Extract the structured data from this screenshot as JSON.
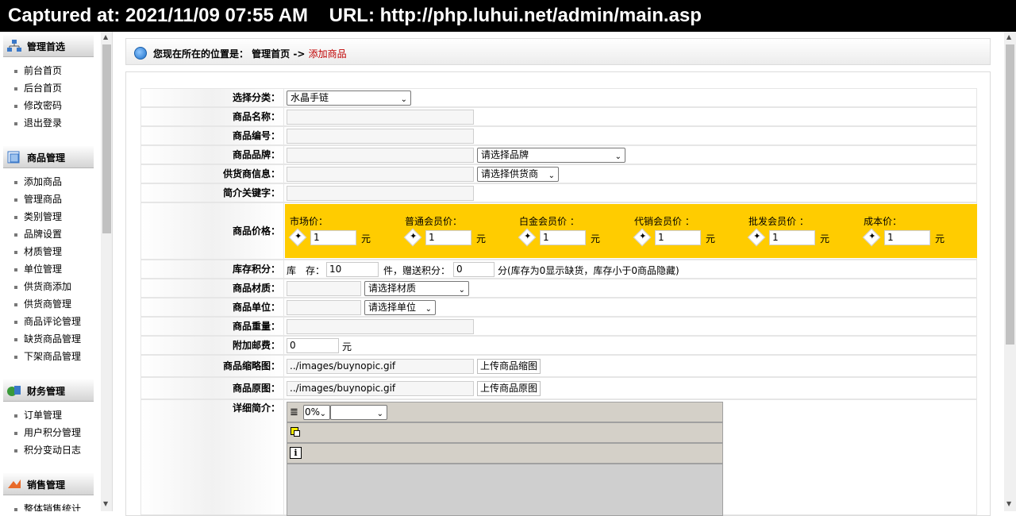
{
  "capture": {
    "text": "Captured at: 2021/11/09 07:55 AM    URL: http://php.luhui.net/admin/main.asp"
  },
  "sidebar": {
    "sections": [
      {
        "title": "管理首选",
        "items": [
          "前台首页",
          "后台首页",
          "修改密码",
          "退出登录"
        ]
      },
      {
        "title": "商品管理",
        "items": [
          "添加商品",
          "管理商品",
          "类别管理",
          "品牌设置",
          "材质管理",
          "单位管理",
          "供货商添加",
          "供货商管理",
          "商品评论管理",
          "缺货商品管理",
          "下架商品管理"
        ]
      },
      {
        "title": "财务管理",
        "items": [
          "订单管理",
          "用户积分管理",
          "积分变动日志"
        ]
      },
      {
        "title": "销售管理",
        "items": [
          "整体销售统计"
        ]
      }
    ]
  },
  "breadcrumb": {
    "prefix": "您现在所在的位置是： 管理首页 ->",
    "current": "添加商品"
  },
  "form": {
    "category": {
      "label": "选择分类：",
      "value": "水晶手链"
    },
    "name": {
      "label": "商品名称：",
      "value": ""
    },
    "code": {
      "label": "商品编号：",
      "value": ""
    },
    "brand": {
      "label": "商品品牌：",
      "value": "",
      "select": "请选择品牌"
    },
    "supplier": {
      "label": "供货商信息：",
      "value": "",
      "select": "请选择供货商"
    },
    "keywords": {
      "label": "简介关键字：",
      "value": ""
    },
    "price": {
      "label": "商品价格：",
      "unit": "元",
      "items": [
        {
          "label": "市场价：",
          "value": "1"
        },
        {
          "label": "普通会员价：",
          "value": "1"
        },
        {
          "label": "白金会员价 ：",
          "value": "1"
        },
        {
          "label": "代销会员价 ：",
          "value": "1"
        },
        {
          "label": "批发会员价 ：",
          "value": "1"
        },
        {
          "label": "成本价：",
          "value": "1"
        }
      ]
    },
    "stock": {
      "label": "库存积分：",
      "stock_label": "库　存：",
      "stock_value": "10",
      "points_label": "件，赠送积分：",
      "points_value": "0",
      "note": "分(库存为0显示缺货，库存小于0商品隐藏)"
    },
    "material": {
      "label": "商品材质：",
      "value": "",
      "select": "请选择材质"
    },
    "unit": {
      "label": "商品单位：",
      "value": "",
      "select": "请选择单位"
    },
    "weight": {
      "label": "商品重量：",
      "value": ""
    },
    "postage": {
      "label": "附加邮费：",
      "value": "0",
      "unit": "元"
    },
    "thumb": {
      "label": "商品缩略图：",
      "value": "../images/buynopic.gif",
      "button": "上传商品缩图"
    },
    "original": {
      "label": "商品原图：",
      "value": "../images/buynopic.gif",
      "button": "上传商品原图"
    },
    "detail": {
      "label": "详细简介：",
      "zoom": "0%"
    }
  }
}
